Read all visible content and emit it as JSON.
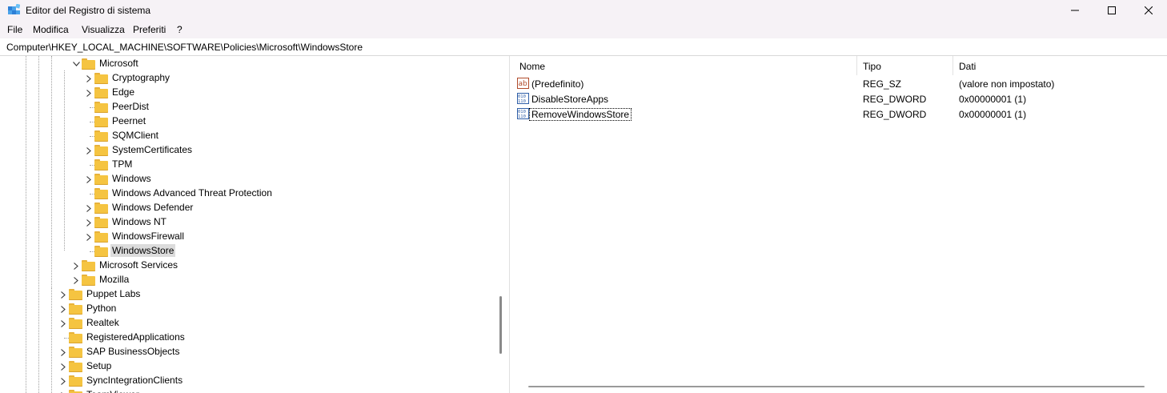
{
  "window": {
    "title": "Editor del Registro di sistema",
    "controls": [
      "minimize",
      "maximize",
      "close"
    ]
  },
  "menu": [
    "File",
    "Modifica",
    "Visualizza",
    "Preferiti",
    "?"
  ],
  "address": "Computer\\HKEY_LOCAL_MACHINE\\SOFTWARE\\Policies\\Microsoft\\WindowsStore",
  "tree": [
    {
      "label": "Microsoft",
      "level": 1,
      "expanded": true
    },
    {
      "label": "Cryptography",
      "level": 2,
      "expandable": true
    },
    {
      "label": "Edge",
      "level": 2,
      "expandable": true
    },
    {
      "label": "PeerDist",
      "level": 2,
      "expandable": false
    },
    {
      "label": "Peernet",
      "level": 2,
      "expandable": false
    },
    {
      "label": "SQMClient",
      "level": 2,
      "expandable": false
    },
    {
      "label": "SystemCertificates",
      "level": 2,
      "expandable": true
    },
    {
      "label": "TPM",
      "level": 2,
      "expandable": false
    },
    {
      "label": "Windows",
      "level": 2,
      "expandable": true
    },
    {
      "label": "Windows Advanced Threat Protection",
      "level": 2,
      "expandable": false
    },
    {
      "label": "Windows Defender",
      "level": 2,
      "expandable": true
    },
    {
      "label": "Windows NT",
      "level": 2,
      "expandable": true
    },
    {
      "label": "WindowsFirewall",
      "level": 2,
      "expandable": true
    },
    {
      "label": "WindowsStore",
      "level": 2,
      "expandable": false,
      "selected": true
    },
    {
      "label": "Microsoft Services",
      "level": 1,
      "expandable": true
    },
    {
      "label": "Mozilla",
      "level": 1,
      "expandable": true
    },
    {
      "label": "Puppet Labs",
      "level": 0,
      "expandable": true
    },
    {
      "label": "Python",
      "level": 0,
      "expandable": true
    },
    {
      "label": "Realtek",
      "level": 0,
      "expandable": true
    },
    {
      "label": "RegisteredApplications",
      "level": 0,
      "expandable": false
    },
    {
      "label": "SAP BusinessObjects",
      "level": 0,
      "expandable": true
    },
    {
      "label": "Setup",
      "level": 0,
      "expandable": true
    },
    {
      "label": "SyncIntegrationClients",
      "level": 0,
      "expandable": true
    },
    {
      "label": "TeamViewer",
      "level": 0,
      "expandable": true
    }
  ],
  "columns": {
    "name": "Nome",
    "type": "Tipo",
    "data": "Dati"
  },
  "values": [
    {
      "name": "(Predefinito)",
      "type": "REG_SZ",
      "data": "(valore non impostato)",
      "icon": "string-value-icon"
    },
    {
      "name": "DisableStoreApps",
      "type": "REG_DWORD",
      "data": "0x00000001 (1)",
      "icon": "binary-value-icon"
    },
    {
      "name": "RemoveWindowsStore",
      "type": "REG_DWORD",
      "data": "0x00000001 (1)",
      "icon": "binary-value-icon",
      "focused": true
    }
  ],
  "colors": {
    "titlebar": "#f6f2f6",
    "folder": "#f5c441",
    "selection": "#dcdcdc"
  }
}
